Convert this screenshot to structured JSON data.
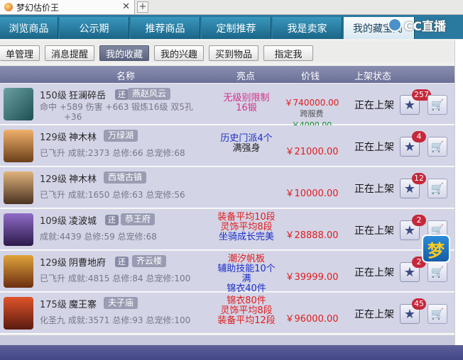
{
  "browser": {
    "tab_title": "梦幻估价王",
    "close_glyph": "✕",
    "newtab_glyph": "+"
  },
  "watermark": {
    "text": "CC直播"
  },
  "main_tabs": [
    {
      "label": "浏览商品"
    },
    {
      "label": "公示期"
    },
    {
      "label": "推荐商品"
    },
    {
      "label": "定制推荐"
    },
    {
      "label": "我是卖家"
    },
    {
      "label": "我的藏宝阁"
    }
  ],
  "sub_tabs": [
    {
      "label": "单管理"
    },
    {
      "label": "消息提醒"
    },
    {
      "label": "我的收藏"
    },
    {
      "label": "我的兴趣"
    },
    {
      "label": "买到物品"
    },
    {
      "label": "指定我"
    }
  ],
  "table": {
    "headers": {
      "name": "名称",
      "highlight": "亮点",
      "price": "价钱",
      "status": "上架状态"
    },
    "rows": [
      {
        "level": "150级",
        "server": "狂澜碎岳",
        "badge": "还",
        "zone": "燕赵风云",
        "stats": "命中 +589 伤害 +663 锻炼16级 双5孔",
        "stats2": "+36",
        "highlight": [
          "无级别限制",
          "16锻"
        ],
        "price": "￥740000.00",
        "fee_label": "跨服费",
        "fee": "￥4000.00",
        "status": "正在上架",
        "fav_count": "257"
      },
      {
        "level": "129级",
        "server": "神木林",
        "badge": "",
        "zone": "万绿湖",
        "stats": "已飞升 成就:2373 总修:66 总宠修:68",
        "highlight": [
          "历史门派4个",
          "满强身"
        ],
        "price": "￥21000.00",
        "status": "正在上架",
        "fav_count": "4"
      },
      {
        "level": "129级",
        "server": "神木林",
        "badge": "",
        "zone": "西塘古镇",
        "stats": "已飞升 成就:1650 总修:63 总宠修:56",
        "highlight": [],
        "price": "￥10000.00",
        "status": "正在上架",
        "fav_count": "12"
      },
      {
        "level": "109级",
        "server": "凌波城",
        "badge": "还",
        "zone": "恭王府",
        "stats": "成就:4439 总修:59 总宠修:68",
        "highlight": [
          "装备平均10段",
          "灵饰平均8段",
          "坐骑成长完美"
        ],
        "price": "￥28888.00",
        "status": "正在上架",
        "fav_count": "2"
      },
      {
        "level": "129级",
        "server": "阴曹地府",
        "badge": "还",
        "zone": "齐云楼",
        "stats": "已飞升 成就:4815 总修:84 总宠修:100",
        "highlight": [
          "潮汐帆板",
          "辅助技能10个满",
          "锦衣40件"
        ],
        "price": "￥39999.00",
        "status": "正在上架",
        "fav_count": "2"
      },
      {
        "level": "175级",
        "server": "魔王寨",
        "badge": "",
        "zone": "夫子庙",
        "stats": "化圣九 成就:3571 总修:93 总宠修:100",
        "highlight": [
          "锦衣80件",
          "灵饰平均8段",
          "装备平均12段"
        ],
        "price": "￥96000.00",
        "status": "正在上架",
        "fav_count": "45"
      }
    ]
  },
  "float_icon": {
    "glyph": "梦"
  },
  "icons": {
    "star": "★",
    "cart": "🛒"
  }
}
